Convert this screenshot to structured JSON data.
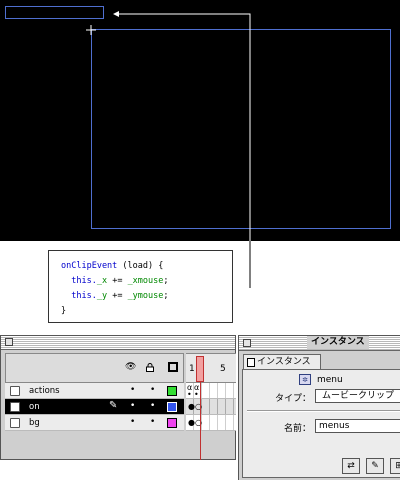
{
  "stage": {
    "background": "#000000",
    "clip_outline_color": "#4f6fd0"
  },
  "code": {
    "lines": [
      {
        "kw": "onClipEvent",
        "rest": " (load) {"
      },
      {
        "prefix": "  this.",
        "prop": "_x",
        "op": " += ",
        "val": "_xmouse",
        "end": ";"
      },
      {
        "prefix": "  this.",
        "prop": "_y",
        "op": " += ",
        "val": "_ymouse",
        "end": ";"
      },
      {
        "close": "}"
      }
    ]
  },
  "timeline": {
    "frame_numbers": [
      "1",
      "5"
    ],
    "layers": [
      {
        "name": "actions",
        "color": "#33dd33",
        "selected": false
      },
      {
        "name": "on",
        "color": "#3355ee",
        "selected": true
      },
      {
        "name": "bg",
        "color": "#ee44ee",
        "selected": false
      }
    ]
  },
  "instance_panel": {
    "title": "インスタンス",
    "tab_label": "インスタンス",
    "symbol_name": "menu",
    "type_label": "タイプ：",
    "type_value": "ムービークリップ",
    "name_label": "名前：",
    "name_value": "menus"
  }
}
